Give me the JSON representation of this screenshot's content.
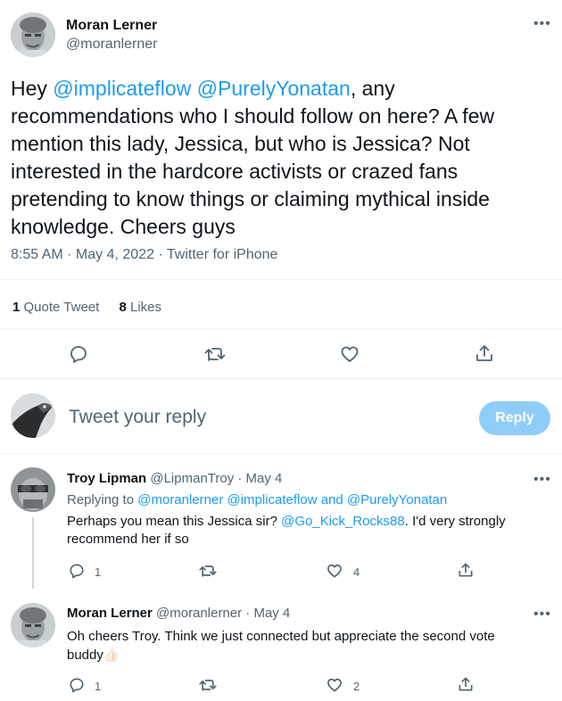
{
  "main_tweet": {
    "author_name": "Moran Lerner",
    "handle": "@moranlerner",
    "text_parts": [
      {
        "t": "Hey ",
        "link": false
      },
      {
        "t": "@implicateflow",
        "link": true
      },
      {
        "t": " ",
        "link": false
      },
      {
        "t": "@PurelyYonatan",
        "link": true
      },
      {
        "t": ", any recommendations who I should follow on here? A few mention this lady, Jessica, but who is Jessica? Not interested in the hardcore activists or crazed fans pretending to know things or claiming mythical inside knowledge. Cheers guys",
        "link": false
      }
    ],
    "meta": "8:55 AM · May 4, 2022 · Twitter for iPhone",
    "stats": {
      "quote_count": "1",
      "quote_label": "Quote Tweet",
      "likes_count": "8",
      "likes_label": "Likes"
    }
  },
  "composer": {
    "placeholder": "Tweet your reply",
    "reply_button": "Reply"
  },
  "replies": [
    {
      "author_name": "Troy Lipman",
      "handle_date": "@LipmanTroy · May 4",
      "replying_prefix": "Replying to ",
      "replying_to": "@moranlerner @implicateflow and @PurelyYonatan",
      "line1_prefix": "Perhaps you mean this Jessica sir? ",
      "line1_link": "@Go_Kick_Rocks88",
      "line1_suffix": ". I'd very strongly",
      "line2": "recommend her if so",
      "reply_count": "1",
      "retweet_count": "",
      "like_count": "4"
    },
    {
      "author_name": "Moran Lerner",
      "handle_date": "@moranlerner · May 4",
      "line1": "Oh cheers Troy. Think we just connected but appreciate the second vote",
      "line2": "buddy",
      "emoji": "👍🏻",
      "reply_count": "1",
      "retweet_count": "",
      "like_count": "2"
    }
  ],
  "colors": {
    "accent": "#1d9bf0",
    "secondary_text": "#536471",
    "reply_button_disabled": "#8ecdf8",
    "divider": "#eff3f4"
  }
}
